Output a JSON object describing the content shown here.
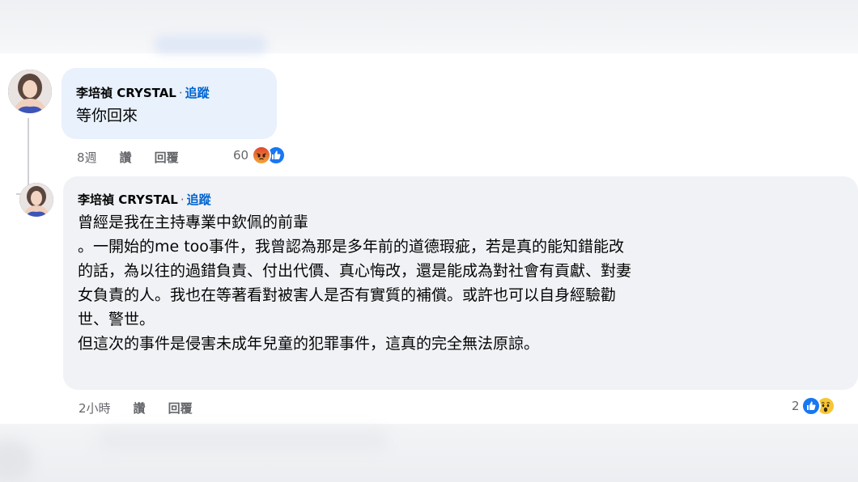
{
  "comments": [
    {
      "author": "李培禎 CRYSTAL",
      "separator": "·",
      "follow_label": "追蹤",
      "text": "等你回來",
      "time": "8週",
      "like_label": "讚",
      "reply_label": "回覆",
      "reaction_count": "60",
      "reaction_icons": [
        "angry-icon",
        "like-icon"
      ]
    },
    {
      "author": "李培禎 CRYSTAL",
      "separator": "·",
      "follow_label": "追蹤",
      "text_lines": [
        "曾經是我在主持專業中欽佩的前輩",
        "。一開始的me too事件，我曾認為那是多年前的道德瑕疵，若是真的能知錯能改",
        "的話，為以往的過錯負責、付出代價、真心悔改，還是能成為對社會有貢獻、對妻",
        "女負責的人。我也在等著看對被害人是否有實質的補償。或許也可以自身經驗勸",
        "世、警世。",
        "但這次的事件是侵害未成年兒童的犯罪事件，這真的完全無法原諒。"
      ],
      "time": "2小時",
      "like_label": "讚",
      "reply_label": "回覆",
      "reaction_count": "2",
      "reaction_icons": [
        "like-icon",
        "wow-icon"
      ]
    }
  ],
  "colors": {
    "link_blue": "#0064d1",
    "bubble_gray": "#f0f2f5",
    "bubble_highlight": "#e8f1fc",
    "meta_gray": "#65676b",
    "like_blue": "#1877f2"
  }
}
